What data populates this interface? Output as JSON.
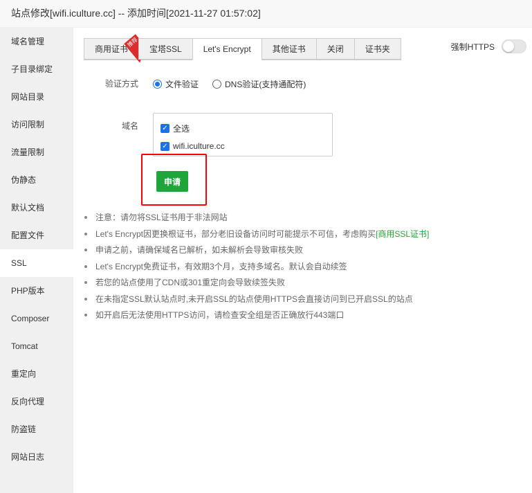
{
  "title": "站点修改[wifi.iculture.cc] -- 添加时间[2021-11-27 01:57:02]",
  "sidebar": {
    "items": [
      "域名管理",
      "子目录绑定",
      "网站目录",
      "访问限制",
      "流量限制",
      "伪静态",
      "默认文档",
      "配置文件",
      "SSL",
      "PHP版本",
      "Composer",
      "Tomcat",
      "重定向",
      "反向代理",
      "防盗链",
      "网站日志"
    ],
    "active": "SSL"
  },
  "tabs": [
    "商用证书",
    "宝塔SSL",
    "Let's Encrypt",
    "其他证书",
    "关闭",
    "证书夹"
  ],
  "ribbon": "推荐",
  "force_https": {
    "label": "强制HTTPS",
    "on": false
  },
  "verify": {
    "label": "验证方式",
    "opt1": "文件验证",
    "opt2": "DNS验证(支持通配符)"
  },
  "domain": {
    "label": "域名",
    "select_all": "全选",
    "items": [
      "wifi.iculture.cc"
    ]
  },
  "apply_label": "申请",
  "notes": {
    "n0": "注意：请勿将SSL证书用于非法网站",
    "n1": "Let's Encrypt因更换根证书，部分老旧设备访问时可能提示不可信，考虑购买",
    "n1_link": "[商用SSL证书]",
    "n2": "申请之前，请确保域名已解析，如未解析会导致审核失败",
    "n3": "Let's Encrypt免费证书，有效期3个月，支持多域名。默认会自动续签",
    "n4": "若您的站点使用了CDN或301重定向会导致续签失败",
    "n5": "在未指定SSL默认站点时,未开启SSL的站点使用HTTPS会直接访问到已开启SSL的站点",
    "n6": "如开启后无法使用HTTPS访问，请检查安全组是否正确放行443端口"
  }
}
